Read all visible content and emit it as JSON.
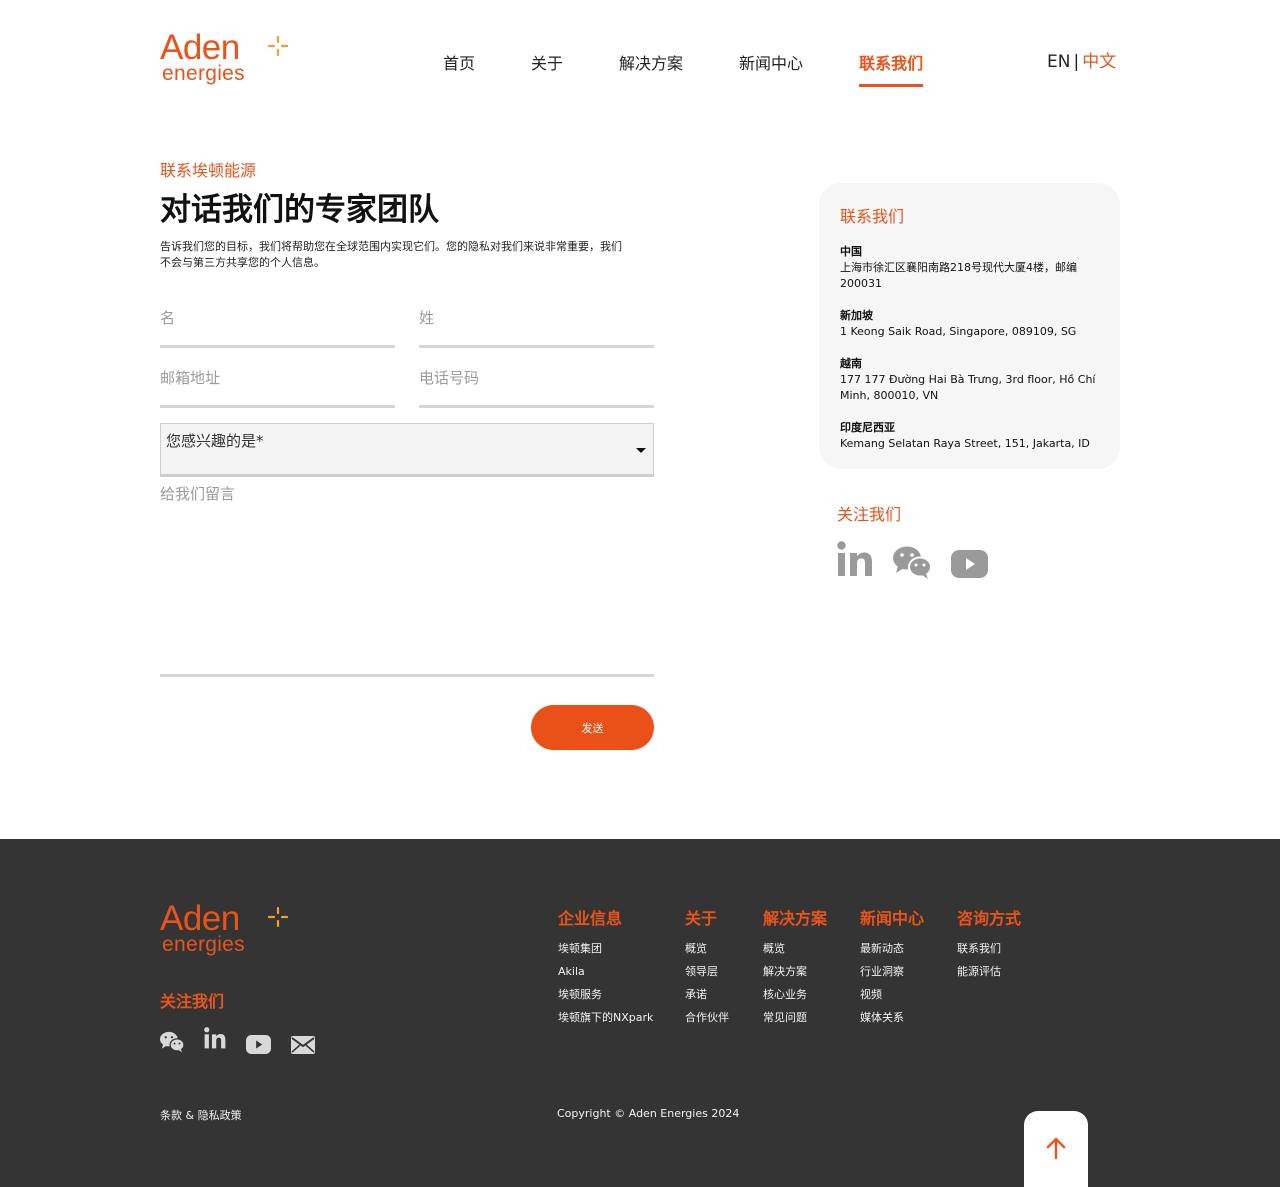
{
  "colors": {
    "accent": "#e8541c",
    "footer_bg": "#343434",
    "card_bg": "#f6f6f6"
  },
  "brand": {
    "name": "Aden",
    "sub": "energies"
  },
  "nav": {
    "items": [
      {
        "label": "首页"
      },
      {
        "label": "关于"
      },
      {
        "label": "解决方案"
      },
      {
        "label": "新闻中心"
      },
      {
        "label": "联系我们",
        "active": true
      }
    ]
  },
  "lang": {
    "en": "EN",
    "sep": "|",
    "zh": "中文"
  },
  "hero": {
    "eyebrow": "联系埃顿能源",
    "title": "对话我们的专家团队",
    "intro": "告诉我们您的目标，我们将帮助您在全球范围内实现它们。您的隐私对我们来说非常重要，我们不会与第三方共享您的个人信息。"
  },
  "form": {
    "first_name": {
      "placeholder": "名",
      "value": ""
    },
    "last_name": {
      "placeholder": "姓",
      "value": ""
    },
    "email": {
      "placeholder": "邮箱地址",
      "value": ""
    },
    "phone": {
      "placeholder": "电话号码",
      "value": ""
    },
    "interest": {
      "label": "您感兴趣的是*"
    },
    "message": {
      "placeholder": "给我们留言",
      "value": ""
    },
    "submit": "发送"
  },
  "contact_card": {
    "title": "联系我们",
    "offices": [
      {
        "name": "中国",
        "address": "上海市徐汇区襄阳南路218号现代大厦4楼，邮编200031"
      },
      {
        "name": "新加坡",
        "address": "1 Keong Saik Road, Singapore, 089109, SG"
      },
      {
        "name": "越南",
        "address": "177 177 Đường Hai Bà Trưng, 3rd floor, Hồ Chí Minh, 800010, VN"
      },
      {
        "name": "印度尼西亚",
        "address": "Kemang Selatan Raya Street, 151, Jakarta, ID"
      }
    ]
  },
  "follow": {
    "title": "关注我们",
    "icons": [
      "linkedin-icon",
      "wechat-icon",
      "youtube-icon"
    ]
  },
  "footer": {
    "follow_title": "关注我们",
    "icons": [
      "wechat-icon",
      "linkedin-icon",
      "youtube-icon",
      "mail-icon"
    ],
    "columns": [
      {
        "title": "企业信息",
        "links": [
          "埃顿集团",
          "Akila",
          "埃顿服务",
          "埃顿旗下的NXpark"
        ]
      },
      {
        "title": "关于",
        "links": [
          "概览",
          "领导层",
          "承诺",
          "合作伙伴"
        ]
      },
      {
        "title": "解决方案",
        "links": [
          "概览",
          "解决方案",
          "核心业务",
          "常见问题"
        ]
      },
      {
        "title": "新闻中心",
        "links": [
          "最新动态",
          "行业洞察",
          "视频",
          "媒体关系"
        ]
      },
      {
        "title": "咨询方式",
        "links": [
          "联系我们",
          "能源评估"
        ]
      }
    ],
    "terms": "条款 & 隐私政策",
    "copyright": "Copyright © Aden Energies 2024"
  }
}
